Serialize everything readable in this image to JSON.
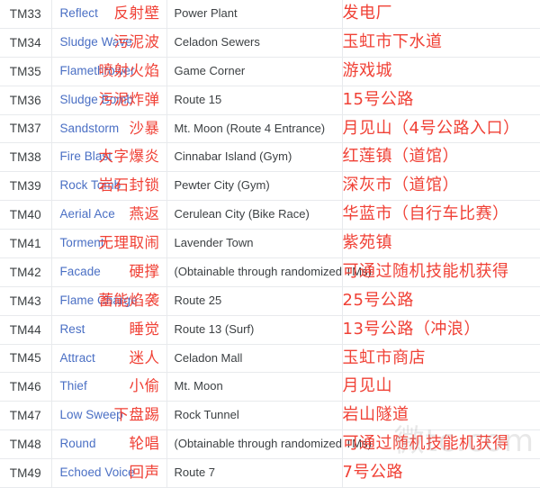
{
  "table": {
    "columns": [
      "tm_id",
      "move",
      "location_en",
      "location_cn"
    ],
    "rows": [
      {
        "tm_id": "TM33",
        "move_en": "Reflect",
        "move_cn": "反射壁",
        "location_en": "Power Plant",
        "location_cn": "发电厂"
      },
      {
        "tm_id": "TM34",
        "move_en": "Sludge Wave",
        "move_cn": "污泥波",
        "location_en": "Celadon Sewers",
        "location_cn": "玉虹市下水道"
      },
      {
        "tm_id": "TM35",
        "move_en": "Flamethrower",
        "move_cn": "喷射火焰",
        "location_en": "Game Corner",
        "location_cn": "游戏城"
      },
      {
        "tm_id": "TM36",
        "move_en": "Sludge Bomb",
        "move_cn": "污泥炸弹",
        "location_en": "Route 15",
        "location_cn": "15号公路"
      },
      {
        "tm_id": "TM37",
        "move_en": "Sandstorm",
        "move_cn": "沙暴",
        "location_en": "Mt. Moon (Route 4 Entrance)",
        "location_cn": "月见山（4号公路入口）"
      },
      {
        "tm_id": "TM38",
        "move_en": "Fire Blast",
        "move_cn": "大字爆炎",
        "location_en": "Cinnabar Island (Gym)",
        "location_cn": "红莲镇（道馆）"
      },
      {
        "tm_id": "TM39",
        "move_en": "Rock Tomb",
        "move_cn": "岩石封锁",
        "location_en": "Pewter City (Gym)",
        "location_cn": "深灰市（道馆）"
      },
      {
        "tm_id": "TM40",
        "move_en": "Aerial Ace",
        "move_cn": "燕返",
        "location_en": "Cerulean City (Bike Race)",
        "location_cn": "华蓝市（自行车比赛）"
      },
      {
        "tm_id": "TM41",
        "move_en": "Torment",
        "move_cn": "无理取闹",
        "location_en": "Lavender Town",
        "location_cn": "紫苑镇"
      },
      {
        "tm_id": "TM42",
        "move_en": "Facade",
        "move_cn": "硬撑",
        "location_en": "(Obtainable through randomized TMs)",
        "location_cn": "可通过随机技能机获得"
      },
      {
        "tm_id": "TM43",
        "move_en": "Flame Charge",
        "move_cn": "蓄能焰袭",
        "location_en": "Route 25",
        "location_cn": "25号公路"
      },
      {
        "tm_id": "TM44",
        "move_en": "Rest",
        "move_cn": "睡觉",
        "location_en": "Route 13 (Surf)",
        "location_cn": "13号公路（冲浪）"
      },
      {
        "tm_id": "TM45",
        "move_en": "Attract",
        "move_cn": "迷人",
        "location_en": "Celadon Mall",
        "location_cn": "玉虹市商店"
      },
      {
        "tm_id": "TM46",
        "move_en": "Thief",
        "move_cn": "小偷",
        "location_en": "Mt. Moon",
        "location_cn": "月见山"
      },
      {
        "tm_id": "TM47",
        "move_en": "Low Sweep",
        "move_cn": "下盘踢",
        "location_en": "Rock Tunnel",
        "location_cn": "岩山隧道"
      },
      {
        "tm_id": "TM48",
        "move_en": "Round",
        "move_cn": "轮唱",
        "location_en": "(Obtainable through randomized TMs)",
        "location_cn": "可通过随机技能机获得"
      },
      {
        "tm_id": "TM49",
        "move_en": "Echoed Voice",
        "move_cn": "回声",
        "location_en": "Route 7",
        "location_cn": "7号公路"
      }
    ]
  },
  "watermark": {
    "text": "微tc.com"
  },
  "colors": {
    "move_link": "#4a6fc4",
    "chinese_text": "#f04136",
    "body_text": "#3c4043",
    "row_border": "#e8eaed"
  }
}
